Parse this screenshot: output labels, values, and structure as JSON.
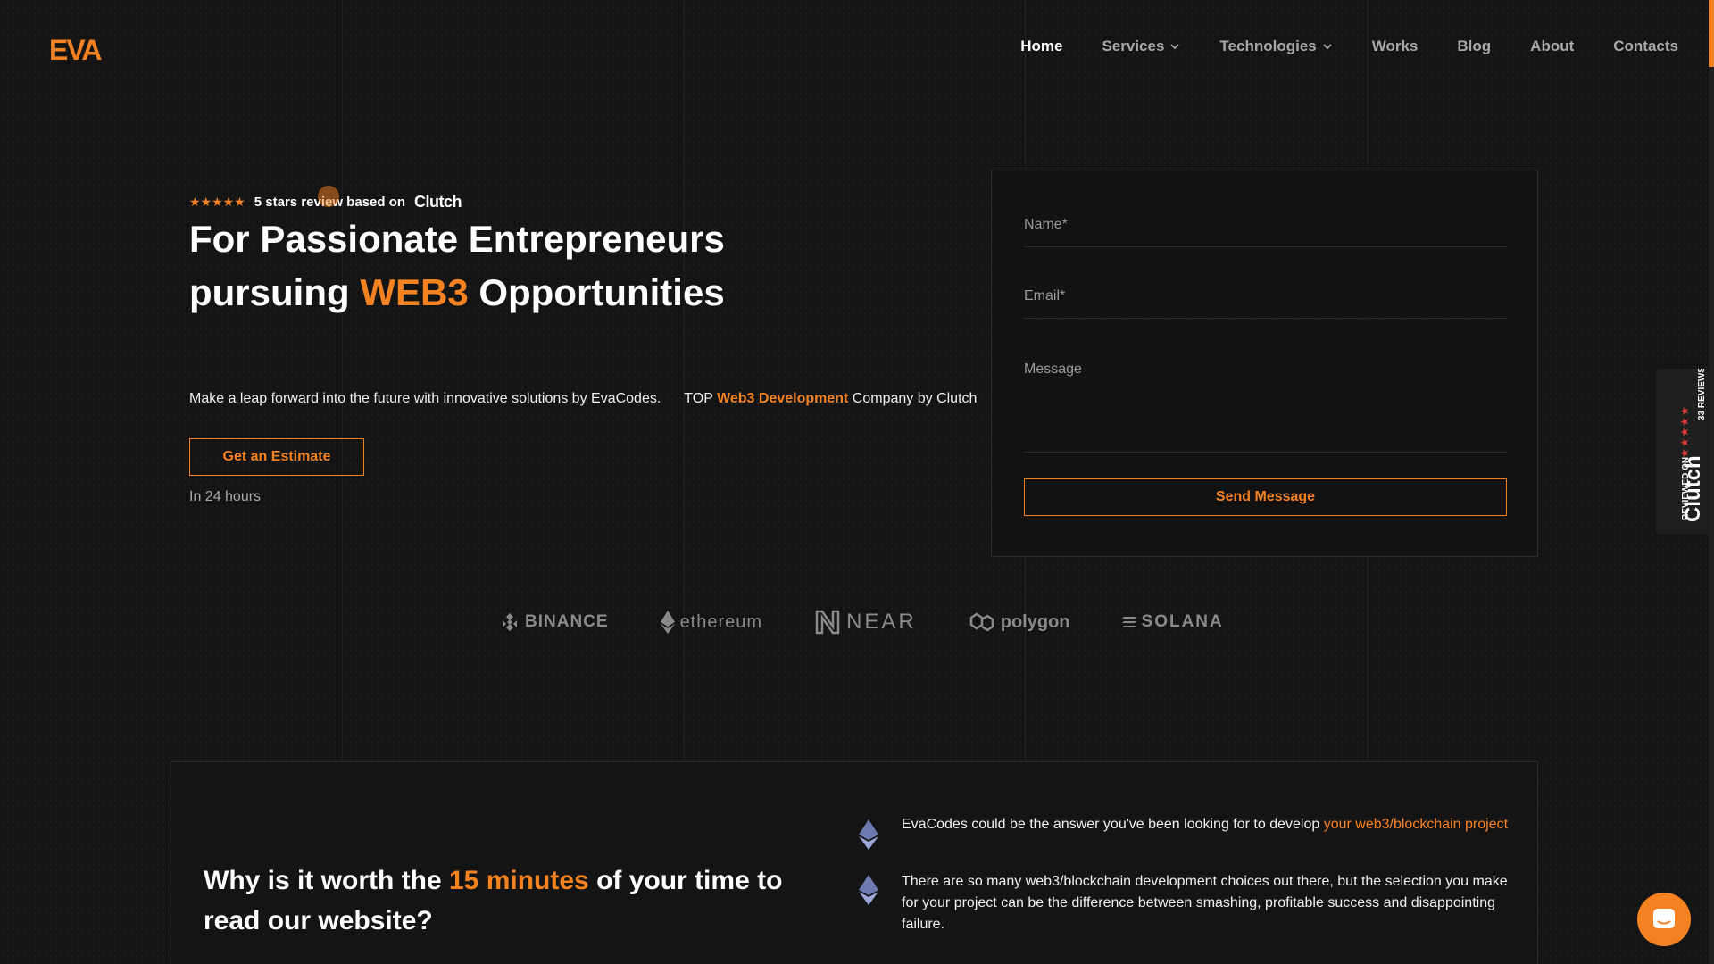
{
  "brand": {
    "logo_text": "EVA",
    "accent": "#f58220"
  },
  "nav": {
    "items": [
      {
        "label": "Home",
        "active": true,
        "dropdown": false
      },
      {
        "label": "Services",
        "active": false,
        "dropdown": true
      },
      {
        "label": "Technologies",
        "active": false,
        "dropdown": true
      },
      {
        "label": "Works",
        "active": false,
        "dropdown": false
      },
      {
        "label": "Blog",
        "active": false,
        "dropdown": false
      },
      {
        "label": "About",
        "active": false,
        "dropdown": false
      },
      {
        "label": "Contacts",
        "active": false,
        "dropdown": false
      }
    ]
  },
  "hero": {
    "stars": "★★★★★",
    "rating_text": "5 stars review based on",
    "rating_source": "Clutch",
    "title_line1": "For Passionate Entrepreneurs",
    "title_line2_pre": "pursuing ",
    "title_line2_accent": "WEB3",
    "title_line2_post": " Opportunities",
    "description": "Make a leap forward into the future with innovative solutions by EvaCodes.",
    "top_pre": "TOP ",
    "top_accent": "Web3 Development",
    "top_post": " Company by Clutch",
    "cta_label": "Get an Estimate",
    "cta_note": "In 24 hours"
  },
  "form": {
    "name_label": "Name*",
    "email_label": "Email*",
    "message_label": "Message",
    "submit_label": "Send Message"
  },
  "clutch_badge": {
    "reviewed_on": "REVIEWED ON",
    "brand": "Clutch",
    "reviews": "33 REVIEWS",
    "stars": "★★★★★"
  },
  "partners": [
    "BINANCE",
    "ethereum",
    "NEAR",
    "polygon",
    "SOLANA"
  ],
  "why": {
    "title_pre": "Why is it worth the ",
    "title_accent": "15 minutes",
    "title_post": " of your time to read our website?",
    "points": [
      {
        "text": "EvaCodes could be the answer you've been looking for to develop ",
        "link": "your web3/blockchain project"
      },
      {
        "text": "There are so many web3/blockchain development choices out there, but the selection you make for your project can be the difference between smashing, profitable success and disappointing failure.",
        "link": ""
      }
    ]
  },
  "icons": [
    "chevron-down-icon",
    "star-icon",
    "ethereum-diamond-icon",
    "chat-icon"
  ]
}
